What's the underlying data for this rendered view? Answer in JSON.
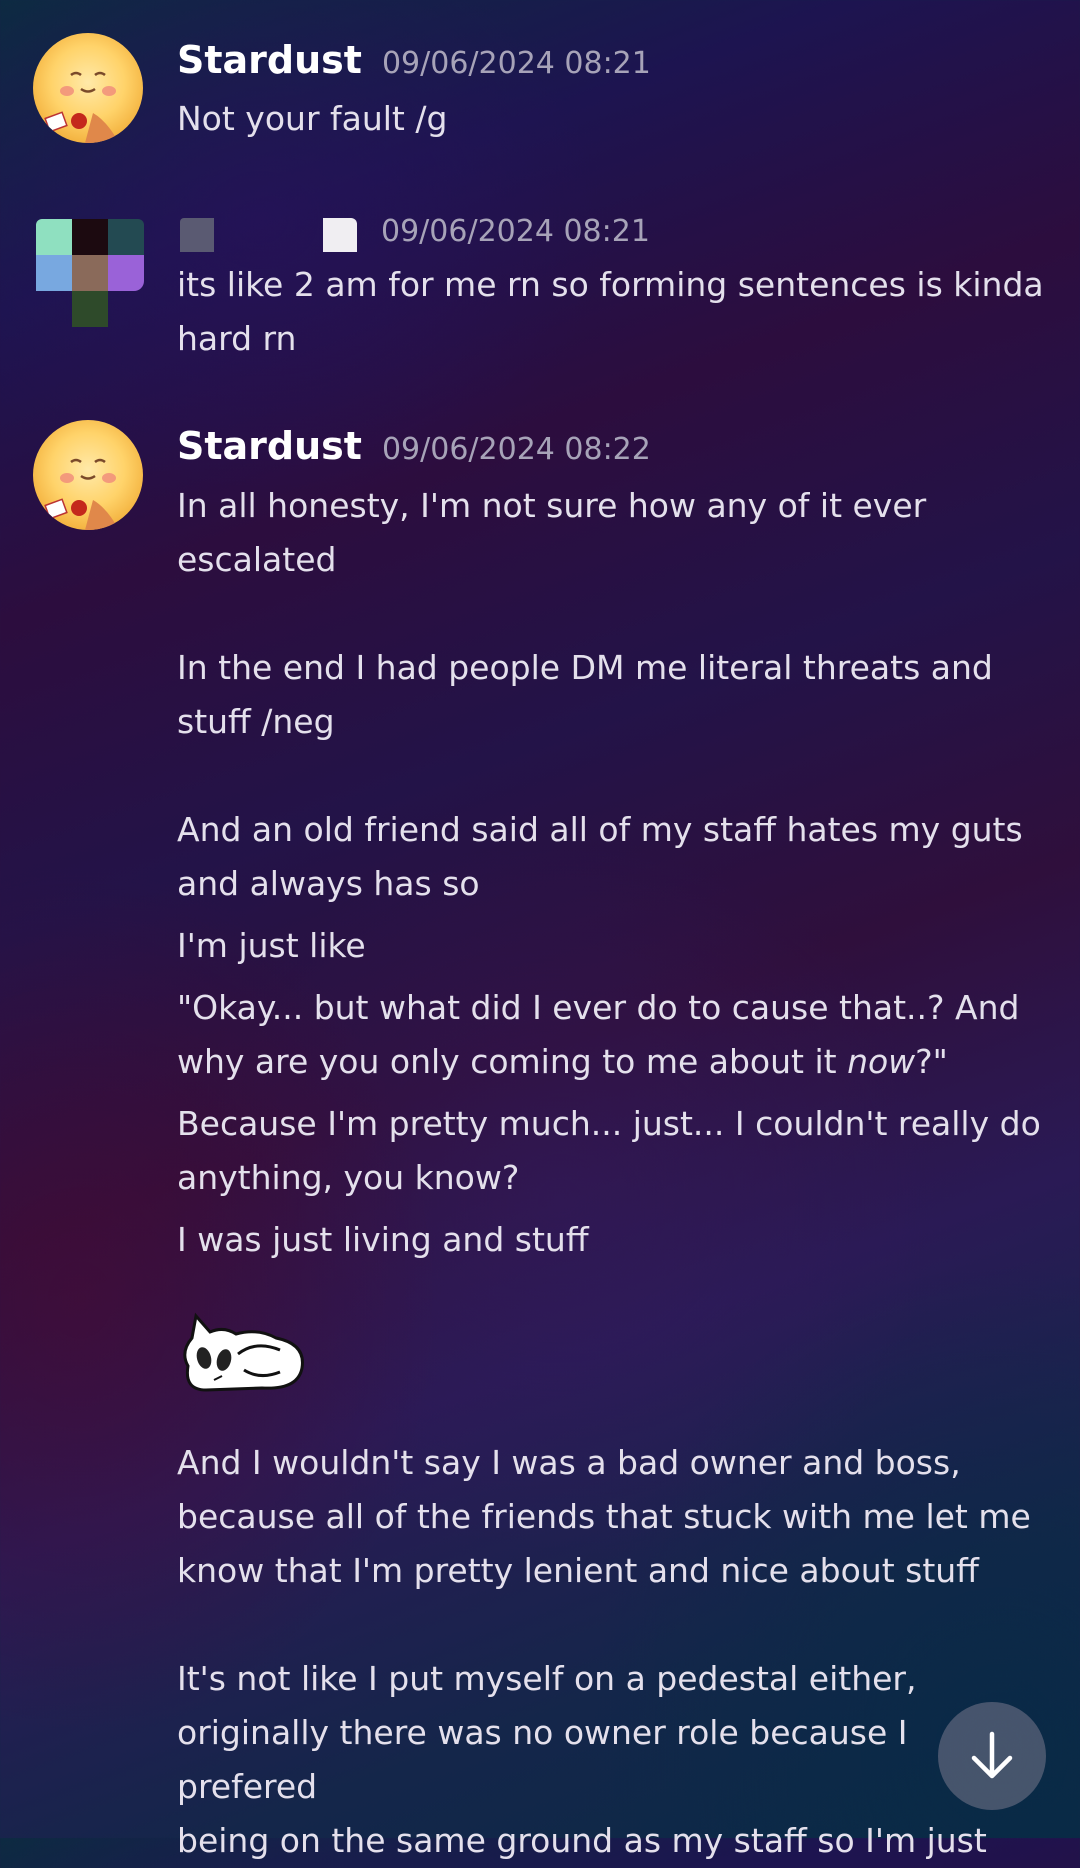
{
  "messages": [
    {
      "username": "Stardust",
      "timestamp": "09/06/2024 08:21",
      "lines": [
        "Not your fault /g"
      ]
    },
    {
      "username": "",
      "timestamp": "09/06/2024 08:21",
      "lines": [
        "its like 2 am for me rn so forming sentences is kinda",
        "hard rn"
      ]
    },
    {
      "username": "Stardust",
      "timestamp": "09/06/2024 08:22",
      "lines": [
        "In all honesty, I'm not sure how any of it ever",
        "escalated",
        "In the end I had people DM me literal threats and",
        "stuff /neg",
        "And an old friend said all of my staff hates my guts",
        "and always has so",
        "I'm just like",
        "\"Okay... but what did I ever do to cause that..? And",
        "why are you only coming to me about it ",
        "now",
        "?\"",
        "Because I'm pretty much... just... I couldn't really do",
        "anything, you know?",
        "I was just living and stuff",
        "And I wouldn't say I was a bad owner and boss,",
        "because all of the friends that stuck with me let me",
        "know that I'm pretty lenient and nice about stuff",
        "It's not like I put myself on a pedestal either,",
        "originally there was no owner role because I prefered",
        "being on the same ground as my staff so I'm just"
      ]
    }
  ],
  "icons": {
    "avatar": "cartoon-character-avatar-icon",
    "pixel_avatar": "pixelated-avatar-icon",
    "sticker": "sleeping-cat-sticker-icon",
    "scroll": "arrow-down-icon"
  },
  "colors": {
    "username": "#ffffff",
    "timestamp": "#a7a3b8",
    "text": "#e4e0ec",
    "scroll_button": "#787890"
  }
}
